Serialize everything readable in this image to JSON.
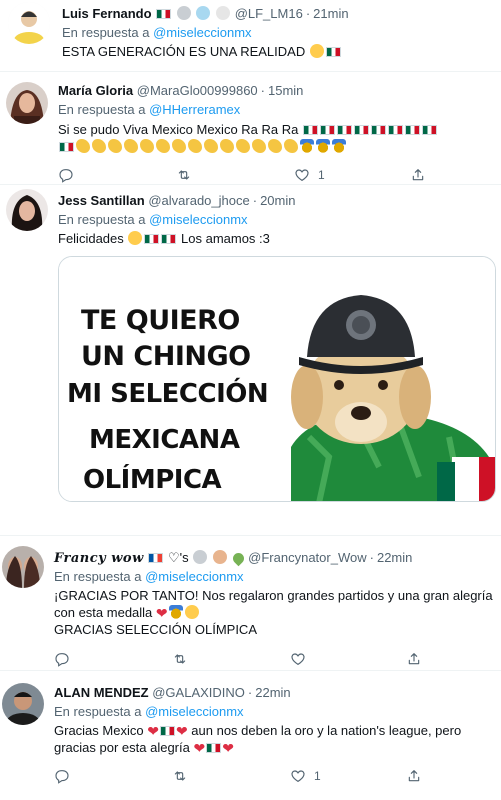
{
  "tweets": [
    {
      "name": "Luis Fernando",
      "handle": "@LF_LM16",
      "time": "21min",
      "reply_prefix": "En respuesta a",
      "reply_to": "@miseleccionmx",
      "text": "ESTA GENERACIÓN ES UNA REALIDAD"
    },
    {
      "name": "María Gloria",
      "handle": "@MaraGlo00999860",
      "time": "15min",
      "reply_prefix": "En respuesta a",
      "reply_to": "@HHerreramex",
      "text": "Si se pudo Viva Mexico Mexico Ra Ra Ra",
      "replies": "",
      "retweets": "",
      "likes": "1"
    },
    {
      "name": "Jess Santillan",
      "handle": "@alvarado_jhoce",
      "time": "20min",
      "reply_prefix": "En respuesta a",
      "reply_to": "@miseleccionmx",
      "text_a": "Felicidades",
      "text_b": "Los amamos :3",
      "meme": {
        "line1": "TE QUIERO",
        "line2": "UN CHINGO",
        "line3": "MI SELECCIÓN",
        "line4": "MEXICANA",
        "line5": "OLÍMPICA"
      }
    },
    {
      "name": "Francy wow",
      "name_suffix": "♡'s",
      "handle": "@Francynator_Wow",
      "time": "22min",
      "reply_prefix": "En respuesta a",
      "reply_to": "@miseleccionmx",
      "line1": "¡GRACIAS POR TANTO! Nos regalaron grandes partidos y una gran alegría",
      "line2": "con esta medalla",
      "line3": "GRACIAS SELECCIÓN OLÍMPICA",
      "likes": ""
    },
    {
      "name": "ALAN MENDEZ",
      "handle": "@GALAXIDINO",
      "time": "22min",
      "reply_prefix": "En respuesta a",
      "reply_to": "@miseleccionmx",
      "line1a": "Gracias Mexico",
      "line1b": "aun nos deben la oro y la nation's league, pero",
      "line2": "gracias por esta alegría",
      "likes": "1"
    }
  ],
  "separator": "·",
  "colors": {
    "link": "#1d9bf0",
    "muted": "#536471",
    "divider": "#eff3f4"
  },
  "icons": [
    "reply-icon",
    "retweet-icon",
    "like-icon",
    "share-icon"
  ]
}
